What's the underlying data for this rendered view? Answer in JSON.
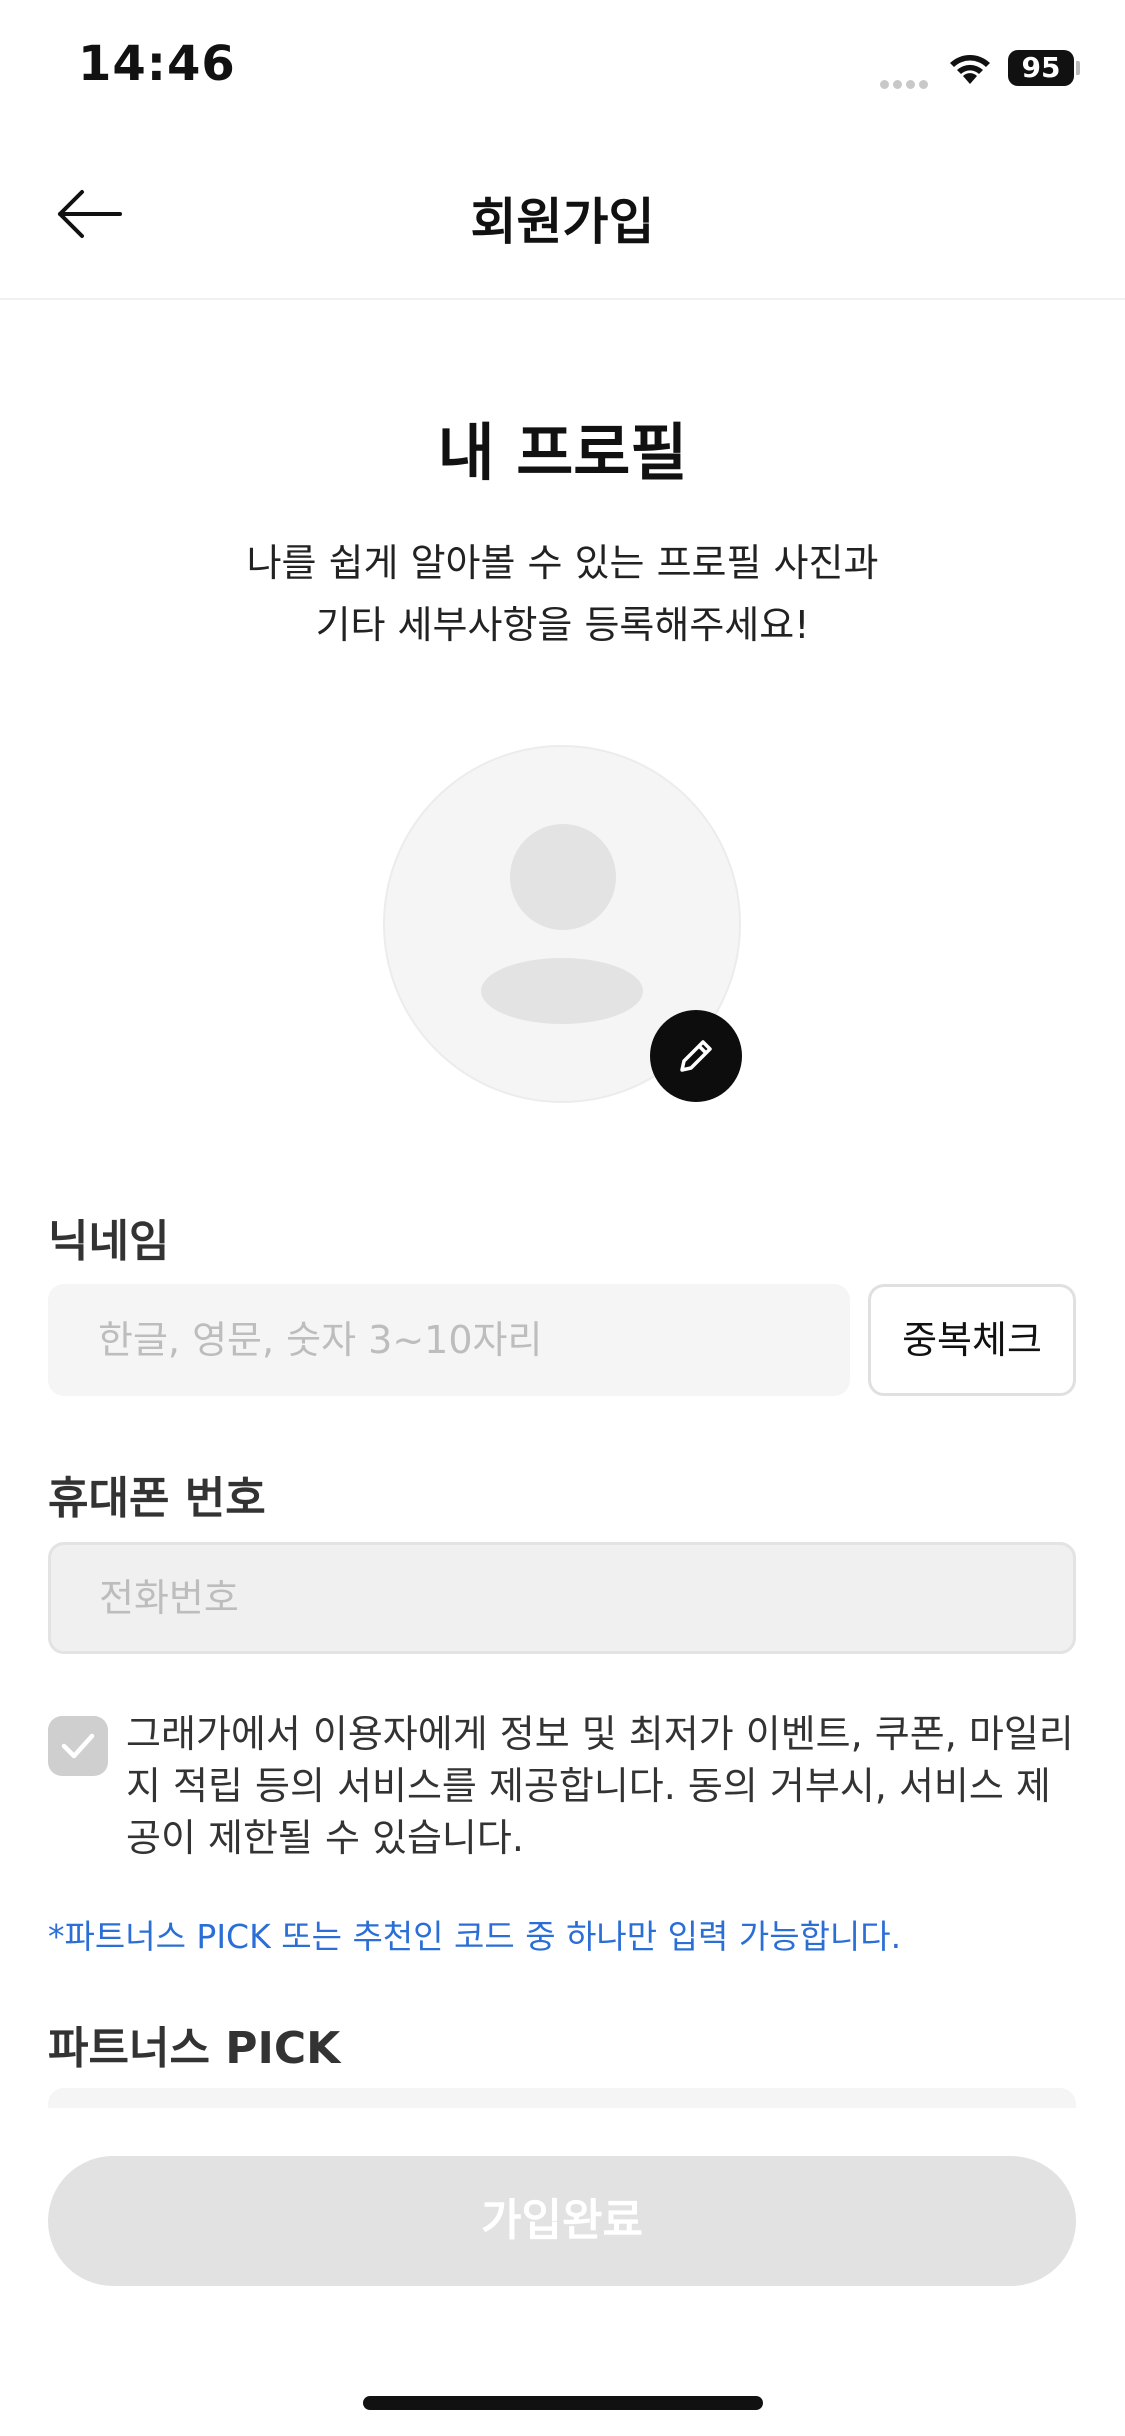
{
  "status_bar": {
    "time": "14:46",
    "battery": "95"
  },
  "header": {
    "title": "회원가입",
    "back_icon": "arrow-left-icon"
  },
  "profile": {
    "title": "내 프로필",
    "description_lines": [
      "나를 쉽게 알아볼 수 있는 프로필 사진과",
      "기타 세부사항을 등록해주세요!"
    ],
    "edit_icon": "pencil-icon"
  },
  "nickname": {
    "label": "닉네임",
    "placeholder": "한글, 영문, 숫자 3~10자리",
    "check_button": "중복체크"
  },
  "phone": {
    "label": "휴대폰 번호",
    "placeholder": "전화번호"
  },
  "consent": {
    "checked": true,
    "lines": [
      "그래가에서 이용자에게 정보 및 최저가 이벤트, 쿠폰, 마일리",
      "지 적립 등의 서비스를 제공합니다. 동의 거부시, 서비스 제",
      "공이 제한될 수 있습니다."
    ]
  },
  "notice": "*파트너스 PICK 또는 추천인 코드 중 하나만 입력 가능합니다.",
  "partner": {
    "label": "파트너스 PICK"
  },
  "submit": {
    "label": "가입완료"
  },
  "colors": {
    "notice_blue": "#2b6fd6",
    "disabled_button": "#e2e2e2",
    "input_bg": "#f5f5f5"
  }
}
